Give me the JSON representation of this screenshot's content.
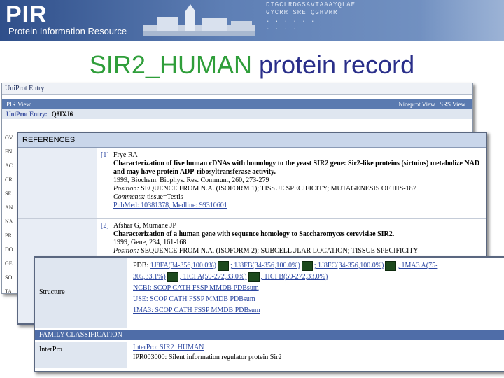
{
  "banner": {
    "logo": "PIR",
    "subtitle": "Protein Information Resource",
    "seq1": "DIGCLRDGSAVTAAAYQLAE",
    "seq2": "GYCRR   SRE QGHVRR",
    "seq3": ".  .      .  .  . .",
    "seq4": "            . . .  ."
  },
  "title": {
    "part1": "SIR2_HUMAN",
    "part2": " protein record"
  },
  "panel1": {
    "header": "UniProt Entry",
    "bar_left": "PIR View",
    "bar_right": "Niceprot View | SRS View",
    "entry_label": "UniProt Entry:",
    "entry_value": "Q8IXJ6",
    "side": [
      "OV",
      "FN",
      "AC",
      "CR",
      "SE",
      "AN",
      "NA",
      "PR",
      "DO",
      "GE",
      "SO",
      "TA"
    ]
  },
  "references": {
    "header": "REFERENCES",
    "items": [
      {
        "num": "[1]",
        "authors": "Frye RA",
        "title": "Characterization of five human cDNAs with homology to the yeast SIR2 gene: Sir2-like proteins (sirtuins) metabolize NAD and may have protein ADP-ribosyltransferase activity.",
        "citation": "1999, Biochem. Biophys. Res. Commun., 260, 273-279",
        "position_label": "Position:",
        "position": "SEQUENCE FROM N.A. (ISOFORM 1); TISSUE SPECIFICITY; MUTAGENESIS OF HIS-187",
        "comments_label": "Comments:",
        "comments": "tissue=Testis",
        "pubmed": "PubMed: 10381378, Medline: 99310601"
      },
      {
        "num": "[2]",
        "authors": "Afshar G, Murnane JP",
        "title": "Characterization of a human gene with sequence homology to Saccharomyces cerevisiae SIR2.",
        "citation": "1999, Gene, 234, 161-168",
        "position_label": "Position:",
        "position": "SEQUENCE FROM N.A. (ISOFORM 2); SUBCELLULAR LOCATION; TISSUE SPECIFICITY"
      }
    ]
  },
  "structure": {
    "label": "Structure",
    "pdb_prefix": "PDB:",
    "pdb_line1": [
      "1J8FA(34-356,100.0%)",
      "; 1J8FB(34-356,100.0%)",
      "; 1J8FC(34-356,100.0%)",
      ", 1MA3 A(75-"
    ],
    "pdb_line2": [
      "305,33.1%)",
      ", 1ICI A(59-272,33.0%)",
      ", 1ICI B(59-272,33.0%)"
    ],
    "line3": "NCBI: SCOP  CATH  FSSP  MMDB  PDBsum",
    "line4": "USE: SCOP  CATH  FSSP  MMDB  PDBsum",
    "line5": "1MA3: SCOP  CATH  FSSP  MMDB  PDBsum"
  },
  "family": {
    "header": "FAMILY CLASSIFICATION",
    "label": "InterPro",
    "line1": "InterPro: SIR2_HUMAN",
    "line2": "IPR003000: Silent information regulator protein Sir2"
  }
}
